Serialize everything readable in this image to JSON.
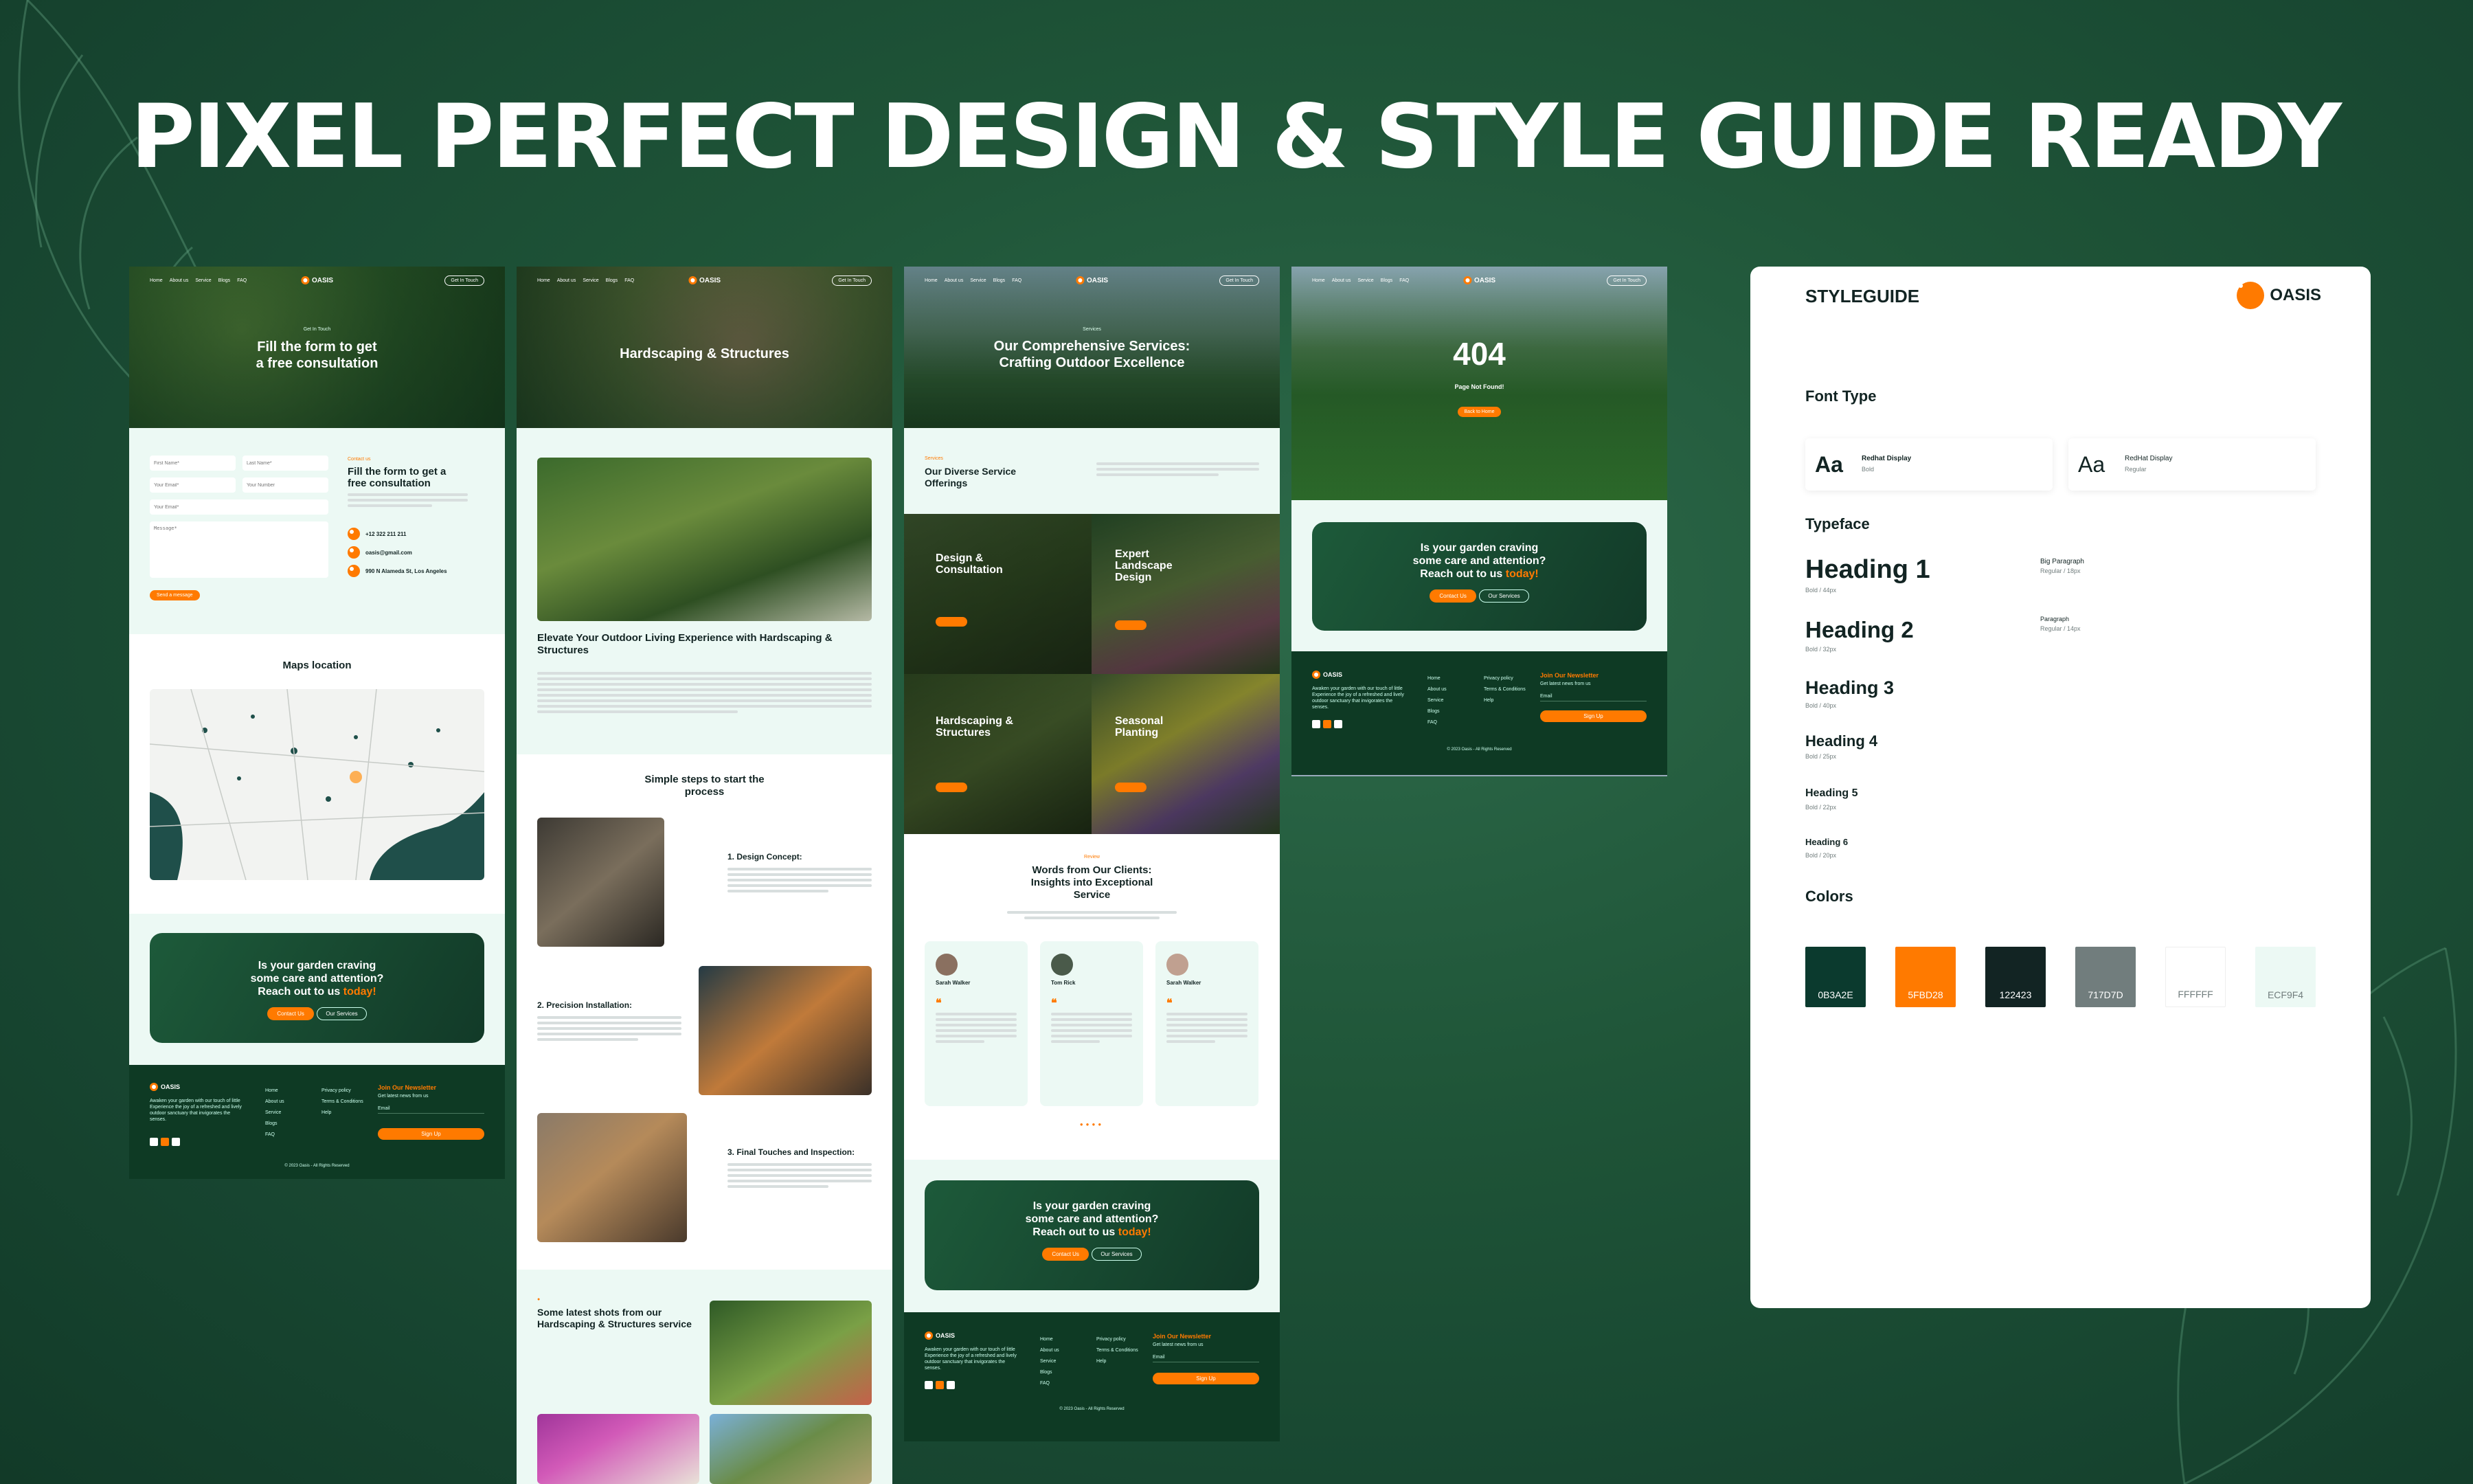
{
  "hero_title": "PIXEL PERFECT DESIGN & STYLE GUIDE READY",
  "brand": "OASIS",
  "nav": {
    "links": [
      "Home",
      "About us",
      "Service",
      "Blogs",
      "FAQ"
    ],
    "cta": "Get In Touch"
  },
  "contact_page": {
    "hero_kicker": "Get In Touch",
    "hero_title_line1": "Fill the form to get",
    "hero_title_line2": "a free consultation",
    "form": {
      "first_name": "First Name*",
      "last_name": "Last Name*",
      "your_email": "Your Email*",
      "your_number": "Your Number",
      "message": "Message*",
      "submit": "Send a message"
    },
    "info_kicker": "Contact us",
    "info_title": "Fill the form to get a free consultation",
    "phone": "+12 322 211 211",
    "email": "oasis@gmail.com",
    "address": "990 N Alameda St, Los Angeles",
    "maps_title": "Maps location"
  },
  "cta": {
    "line1": "Is your garden craving",
    "line2": "some care and attention?",
    "line3": "Reach out to us",
    "accent": "today!",
    "primary": "Contact Us",
    "secondary": "Our Services"
  },
  "footer": {
    "desc": "Awaken your garden with our touch of little Experience the joy of a refreshed and lively outdoor sanctuary that invigorates the senses.",
    "col1": [
      "Home",
      "About us",
      "Service",
      "Blogs",
      "FAQ"
    ],
    "col2": [
      "Privacy policy",
      "Terms & Conditions",
      "Help"
    ],
    "newsletter_title": "Join Our Newsletter",
    "newsletter_sub": "Get latest news from us",
    "email_placeholder": "Email",
    "signup": "Sign Up",
    "copyright": "© 2023 Oasis - All Rights Reserved"
  },
  "detail_page": {
    "hero_title": "Hardscaping & Structures",
    "article_title": "Elevate Your Outdoor Living Experience with Hardscaping & Structures",
    "steps_title_line1": "Simple steps to start the",
    "steps_title_line2": "process",
    "steps": [
      {
        "title": "1. Design Concept:"
      },
      {
        "title": "2. Precision Installation:"
      },
      {
        "title": "3. Final Touches and Inspection:"
      }
    ],
    "gallery_title": "Some latest shots from our Hardscaping & Structures service"
  },
  "services_page": {
    "hero_kicker": "Services",
    "hero_title_line1": "Our Comprehensive Services:",
    "hero_title_line2": "Crafting Outdoor Excellence",
    "intro_kicker": "Services",
    "intro_title": "Our Diverse Service Offerings",
    "services": [
      {
        "title_l1": "Design &",
        "title_l2": "Consultation"
      },
      {
        "title_l1": "Expert",
        "title_l2": "Landscape",
        "title_l3": "Design"
      },
      {
        "title_l1": "Hardscaping &",
        "title_l2": "Structures"
      },
      {
        "title_l1": "Seasonal",
        "title_l2": "Planting"
      }
    ],
    "reviews_kicker": "Review",
    "reviews_title_line1": "Words from Our Clients:",
    "reviews_title_line2": "Insights into Exceptional",
    "reviews_title_line3": "Service",
    "reviews": [
      {
        "name": "Sarah Walker"
      },
      {
        "name": "Tom Rick"
      },
      {
        "name": "Sarah Walker"
      }
    ]
  },
  "error_page": {
    "code": "404",
    "message": "Page Not Found!",
    "button": "Back to Home"
  },
  "styleguide": {
    "title": "STYLEGUIDE",
    "font_type_label": "Font Type",
    "fonts": [
      {
        "sample": "Aa",
        "name": "Redhat Display",
        "weight": "Bold"
      },
      {
        "sample": "Aa",
        "name": "RedHat Display",
        "weight": "Regular"
      }
    ],
    "typeface_label": "Typeface",
    "headings": [
      {
        "name": "Heading 1",
        "spec": "Bold / 44px"
      },
      {
        "name": "Heading 2",
        "spec": "Bold / 32px"
      },
      {
        "name": "Heading 3",
        "spec": "Bold / 40px"
      },
      {
        "name": "Heading 4",
        "spec": "Bold / 25px"
      },
      {
        "name": "Heading 5",
        "spec": "Bold / 22px"
      },
      {
        "name": "Heading 6",
        "spec": "Bold / 20px"
      }
    ],
    "paragraphs": [
      {
        "name": "Big Paragraph",
        "spec": "Regular / 18px"
      },
      {
        "name": "Paragraph",
        "spec": "Regular / 14px"
      }
    ],
    "colors_label": "Colors",
    "colors": [
      {
        "hex": "0B3A2E",
        "value": "#0b3a2e"
      },
      {
        "hex": "5FBD28",
        "value": "#ff7a00"
      },
      {
        "hex": "122423",
        "value": "#122423"
      },
      {
        "hex": "717D7D",
        "value": "#717d7d"
      },
      {
        "hex": "FFFFFF",
        "value": "#ffffff"
      },
      {
        "hex": "ECF9F4",
        "value": "#ecf9f4"
      }
    ]
  }
}
